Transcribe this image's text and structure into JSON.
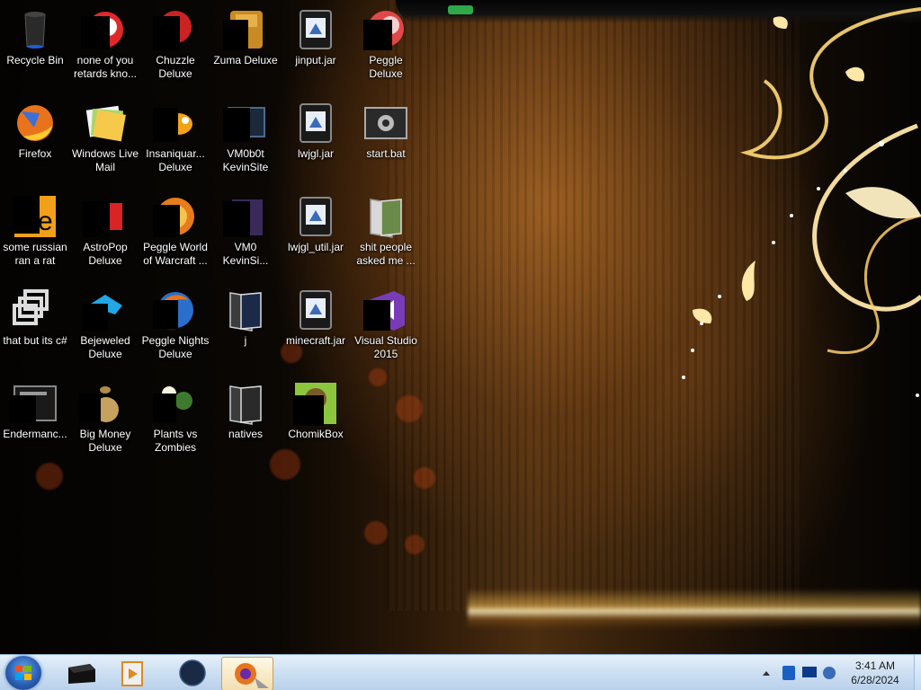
{
  "desktop": {
    "icons": [
      {
        "label": "Recycle Bin"
      },
      {
        "label": "none of you retards kno..."
      },
      {
        "label": "Chuzzle Deluxe"
      },
      {
        "label": "Zuma Deluxe"
      },
      {
        "label": "jinput.jar"
      },
      {
        "label": "Peggle Deluxe"
      },
      {
        "label": "Firefox"
      },
      {
        "label": "Windows Live Mail"
      },
      {
        "label": "Insaniquar... Deluxe"
      },
      {
        "label": "VM0b0t KevinSite"
      },
      {
        "label": "lwjgl.jar"
      },
      {
        "label": "start.bat"
      },
      {
        "label": "some russian ran a rat"
      },
      {
        "label": "AstroPop Deluxe"
      },
      {
        "label": "Peggle World of Warcraft ..."
      },
      {
        "label": "VM0 KevinSi..."
      },
      {
        "label": "lwjgl_util.jar"
      },
      {
        "label": "shit people asked me ..."
      },
      {
        "label": "that but its c#"
      },
      {
        "label": "Bejeweled Deluxe"
      },
      {
        "label": "Peggle Nights Deluxe"
      },
      {
        "label": "j"
      },
      {
        "label": "minecraft.jar"
      },
      {
        "label": "Visual Studio 2015"
      },
      {
        "label": "Endermanc..."
      },
      {
        "label": "Big Money Deluxe"
      },
      {
        "label": "Plants vs Zombies"
      },
      {
        "label": "natives"
      },
      {
        "label": "ChomikBox"
      }
    ]
  },
  "taskbar": {
    "start_icon": "windows-start-orb",
    "pinned": [
      {
        "icon": "black-box-icon"
      },
      {
        "icon": "media-player-icon"
      },
      {
        "icon": "dark-globe-icon"
      },
      {
        "icon": "firefox-icon",
        "active": true
      }
    ],
    "tray_icons": [
      "tray-expand-arrow-icon",
      "bluetooth-icon",
      "monitor-icon",
      "network-icon"
    ]
  },
  "clock": {
    "time": "3:41 AM",
    "date": "6/28/2024"
  },
  "colors": {
    "taskbar": "#cfe0f2",
    "label_text": "#ffffff",
    "accent_green": "#2ea84a"
  }
}
